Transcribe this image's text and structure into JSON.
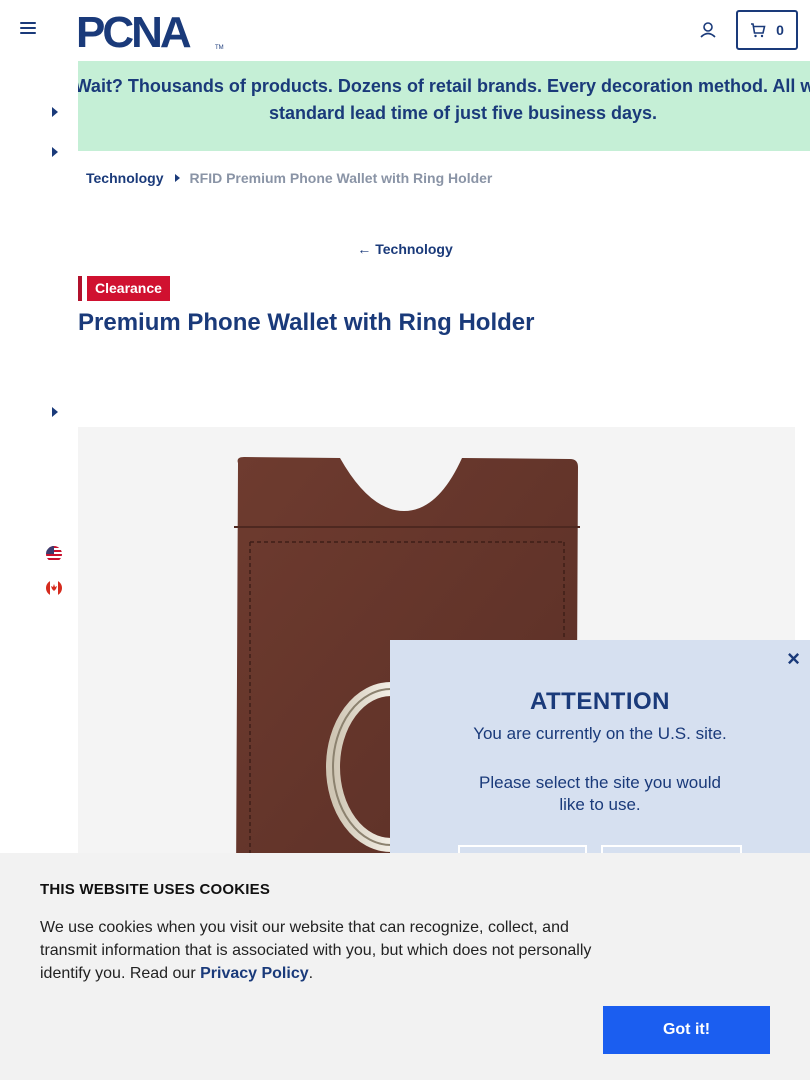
{
  "header": {
    "logo_text": "PCNA",
    "logo_tm": "TM",
    "cart_count": "0"
  },
  "promo": {
    "text": "Wait? Thousands of products. Dozens of retail brands. Every decoration method. All with a standard lead time of just five business days."
  },
  "breadcrumb": {
    "category": "Technology",
    "current": "RFID Premium Phone Wallet with Ring Holder"
  },
  "back_link": {
    "arrow": "←",
    "label": "Technology"
  },
  "product": {
    "badge": "Clearance",
    "title": "Premium Phone Wallet with Ring Holder",
    "wallet_color": "#6b3a2e"
  },
  "modal": {
    "close": "×",
    "title": "ATTENTION",
    "message": "You are currently on the U.S. site.",
    "prompt": "Please select the site you would like to use."
  },
  "cookie": {
    "title": "THIS WEBSITE USES COOKIES",
    "text_before": "We use cookies when you visit our website that can recognize, collect, and transmit information that is associated with you, but which does not personally identify you. Read our ",
    "link": "Privacy Policy",
    "text_after": ".",
    "button": "Got it!"
  },
  "colors": {
    "brand_navy": "#1a3a7a",
    "promo_bg": "#c5efd6",
    "clearance_red": "#d01130",
    "modal_bg": "#d6e0f0",
    "cookie_button": "#1b5ef0"
  }
}
